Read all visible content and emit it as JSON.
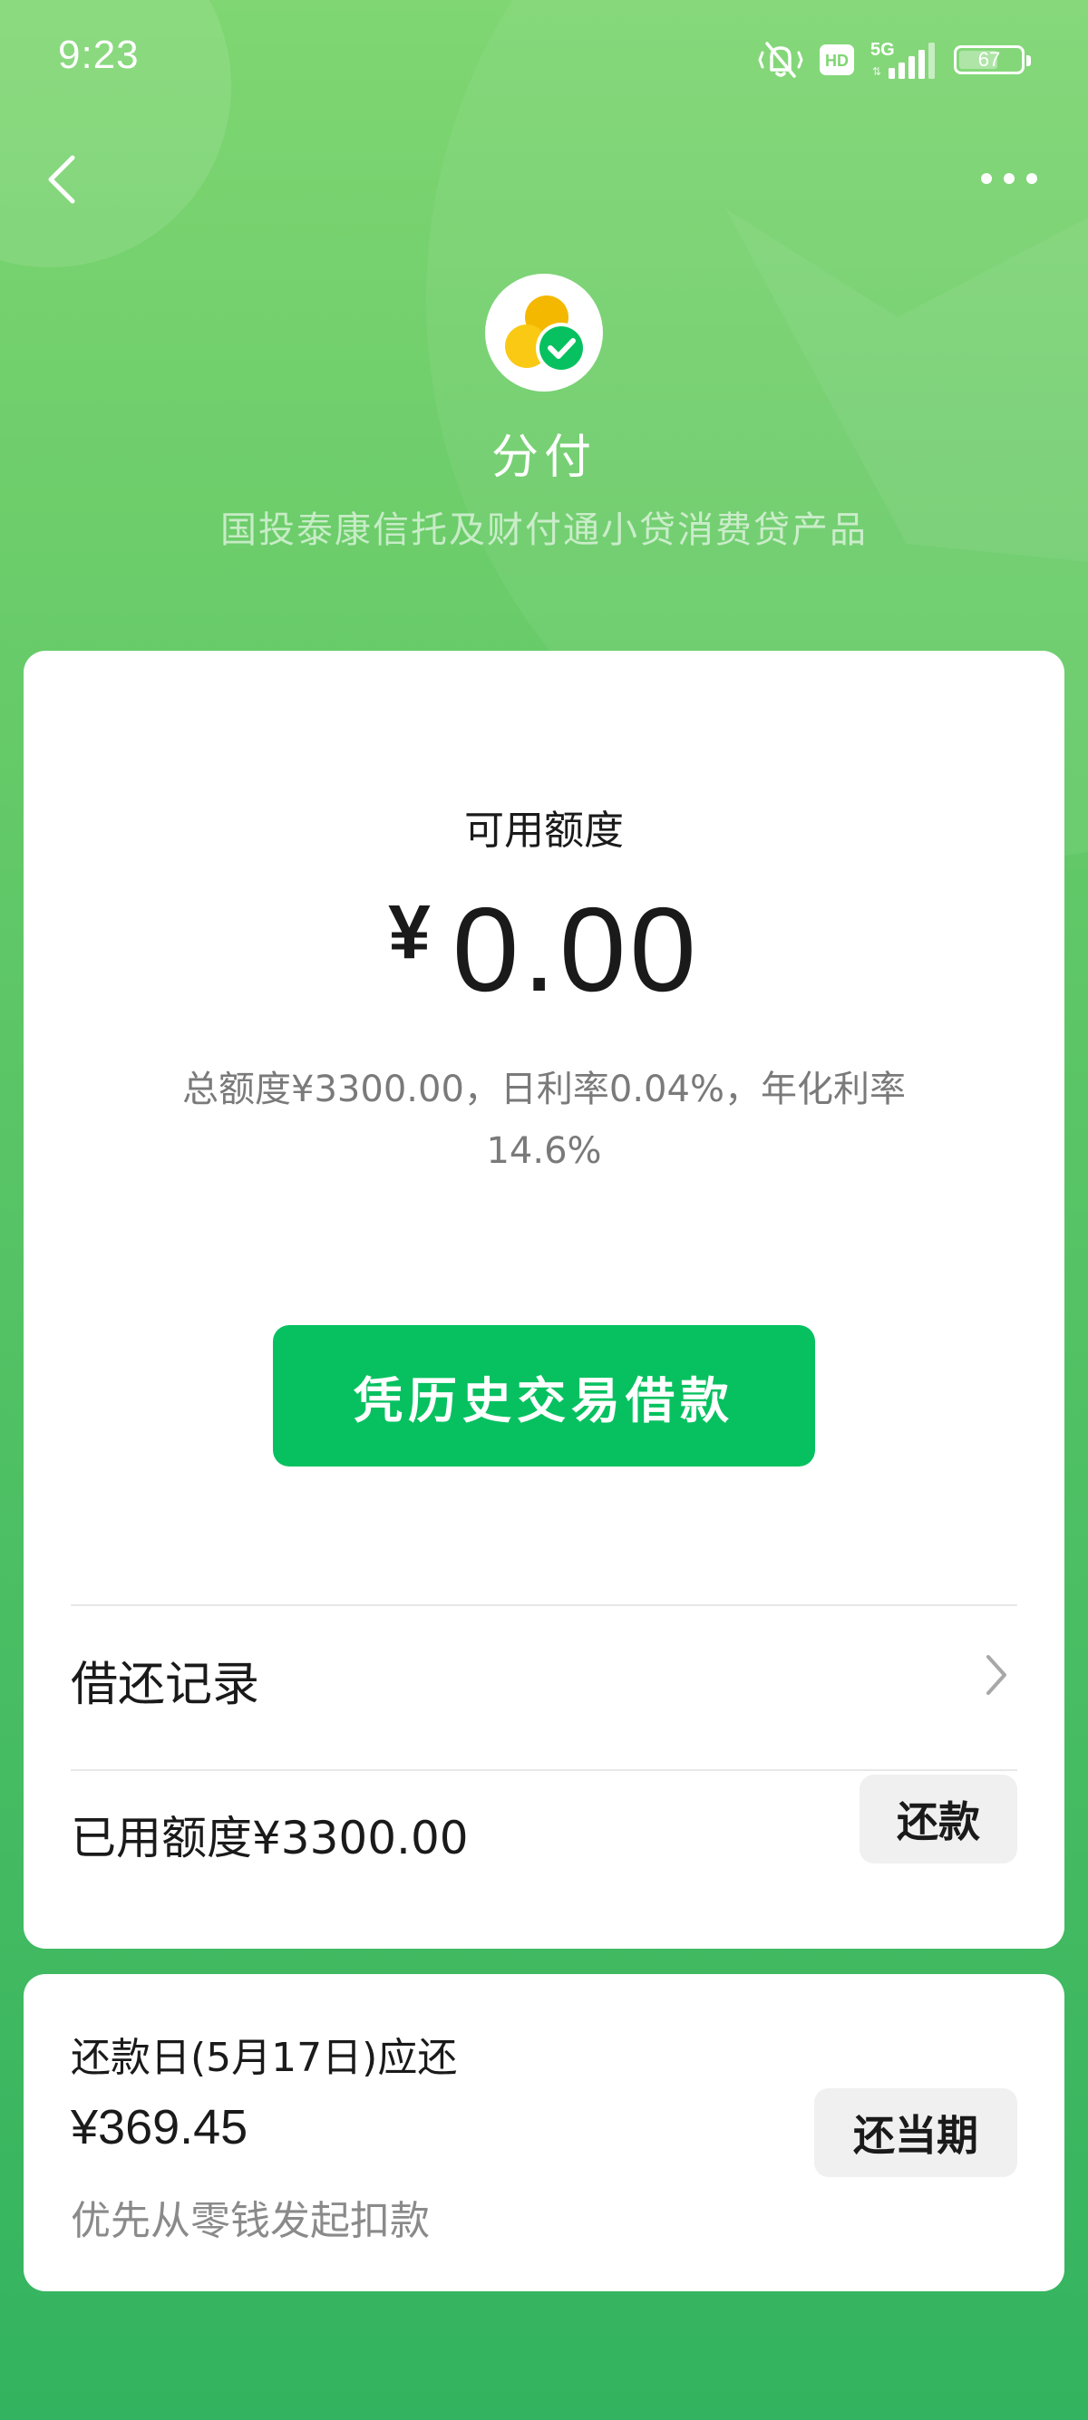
{
  "status_bar": {
    "time": "9:23",
    "icons": [
      "vibrate-mute-icon",
      "hd-icon",
      "signal-5g-icon"
    ],
    "hd_label": "HD",
    "network_label": "5G",
    "battery_level": "67"
  },
  "nav": {
    "back_icon": "chevron-left-icon",
    "more_icon": "more-dots-icon"
  },
  "header": {
    "logo_icon": "fenfu-logo-icon",
    "product_name": "分付",
    "subtitle": "国投泰康信托及财付通小贷消费贷产品"
  },
  "main_card": {
    "available_label": "可用额度",
    "currency_symbol": "¥",
    "available_amount": "0.00",
    "rate_info": "总额度¥3300.00，日利率0.04%，年化利率14.6%",
    "borrow_button": "凭历史交易借款",
    "records_label": "借还记录",
    "used_label": "已用额度¥3300.00",
    "repay_button": "还款"
  },
  "due_card": {
    "title": "还款日(5月17日)应还",
    "amount": "¥369.45",
    "note": "优先从零钱发起扣款",
    "repay_current_button": "还当期"
  },
  "colors": {
    "primary_green": "#07c160",
    "bg_green_top": "#7fd672",
    "bg_green_bottom": "#33b35f"
  }
}
